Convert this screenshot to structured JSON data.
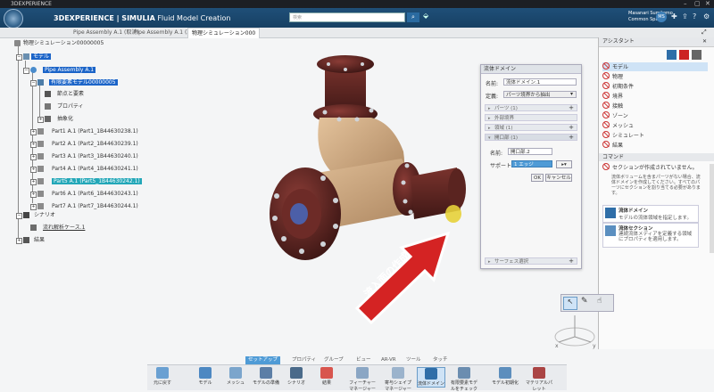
{
  "window": {
    "title": "3DEXPERIENCE"
  },
  "appbar": {
    "brand_prefix": "3D",
    "brand_main": "EXPERIENCE | SIMULIA",
    "brand_app": "Fluid Model Creation",
    "search_placeholder": "検索",
    "user_name": "Masanari Sumitomo",
    "user_space": "Common Space",
    "avatar_initials": "MS"
  },
  "tabs": [
    {
      "label": "Pipe Assembly A.1 (取消)"
    },
    {
      "label": "Pipe Assembly A.1 (取消)"
    },
    {
      "label": "物理シミュレーション000"
    }
  ],
  "tree": {
    "root": "物理シミュレーション00000005",
    "model": "モデル",
    "assembly": "Pipe Assembly A.1",
    "fe_model": "有限要素モデル00000005",
    "nodes_elements": "節点と要素",
    "properties": "プロパティ",
    "abstraction": "抽象化",
    "parts": [
      "Part1 A.1 (Part1_1B44630238.1)",
      "Part2 A.1 (Part2_1B44630239.1)",
      "Part3 A.1 (Part3_1B44630240.1)",
      "Part4 A.1 (Part4_1B44630241.1)",
      "Part5 A.1 (Part5_1B44630242.1)",
      "Part6 A.1 (Part6_1B44630243.1)",
      "Part7 A.1 (Part7_1B44630244.1)"
    ],
    "scenario": "シナリオ",
    "flow_case": "流れ解析ケース.1",
    "results": "結果"
  },
  "dialog": {
    "title": "流体ドメイン",
    "name_label": "名前:",
    "name_value": "流体ドメイン.1",
    "definition_label": "定義:",
    "definition_value": "パーツ境界から抽出",
    "sections": [
      {
        "label": "パーツ (1)"
      },
      {
        "label": "外部境界"
      },
      {
        "label": "領域 (1)"
      },
      {
        "label": "開口部 (1)"
      }
    ],
    "opening_name_label": "名前:",
    "opening_name_value": "開口部.2",
    "support_label": "サポート:",
    "support_value": "1 エッジ",
    "ok_label": "OK",
    "cancel_label": "キャンセル",
    "surface_section": "サーフェス選択"
  },
  "assistant": {
    "title": "アシスタント",
    "items": [
      "モデル",
      "物理",
      "初期条件",
      "境界",
      "接触",
      "ゾーン",
      "メッシュ",
      "シミュレート",
      "結果"
    ],
    "command_header": "コマンド",
    "command_status": "セクションが作成されていません。",
    "command_desc": "流体ボリュームを含まパーツがない場合、流体ドメインを作成してください。すべてのパーツにセクションを割り当てる必要があります。",
    "card1_title": "流体ドメイン",
    "card1_desc": "モデルの流体領域を指定します。",
    "card2_title": "流体セクション",
    "card2_desc": "連続流体メディアを定義する領域にプロパティを適用します。"
  },
  "annotation": {
    "text": "流入面の作成"
  },
  "bottom_tabs": [
    "セットアップ",
    "プロパティ",
    "グループ",
    "ビュー",
    "AR-VR",
    "ツール",
    "タッチ"
  ],
  "toolbar": [
    {
      "label": "元に戻す"
    },
    {
      "label": "モデル"
    },
    {
      "label": "メッシュ"
    },
    {
      "label": "モデルの準備"
    },
    {
      "label": "シナリオ"
    },
    {
      "label": "結果"
    },
    {
      "label": "フィーチャーマネージャー"
    },
    {
      "label": "寄与シェイプマネージャー"
    },
    {
      "label": "流体ドメイン"
    },
    {
      "label": "有限要素モデルをチェック"
    },
    {
      "label": "モデル初期化"
    },
    {
      "label": "マテリアルパレット"
    }
  ],
  "colors": {
    "accent": "#1b64c8",
    "appbar": "#1f4f78",
    "pipe": "#5a2522",
    "fitting": "#c8a27a",
    "arrow": "#c81e1e"
  }
}
